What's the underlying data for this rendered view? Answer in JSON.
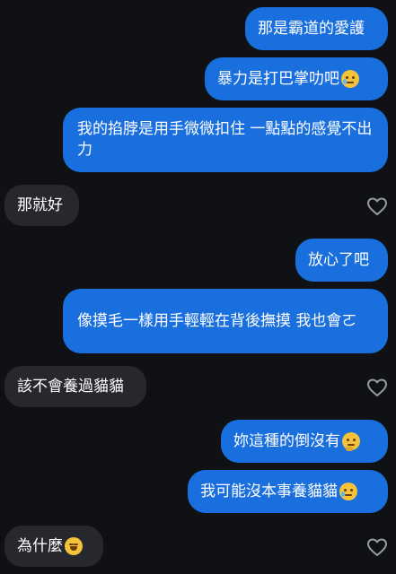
{
  "conversation": {
    "messages": [
      {
        "direction": "outgoing",
        "text": "那是霸道的愛護"
      },
      {
        "direction": "outgoing",
        "text": "暴力是打巴掌叻吧",
        "emoji": "face-holding-back-tears"
      },
      {
        "direction": "outgoing",
        "text": "我的掐脖是用手微微扣住 一點點的感覺不出力"
      },
      {
        "direction": "incoming",
        "text": "那就好"
      },
      {
        "direction": "outgoing",
        "text": "放心了吧"
      },
      {
        "direction": "outgoing",
        "text": "像摸毛一樣用手輕輕在背後撫摸 我也會ㄛ"
      },
      {
        "direction": "incoming",
        "text": "該不會養過貓貓"
      },
      {
        "direction": "outgoing",
        "text": "妳這種的倒沒有",
        "emoji": "thinking-face"
      },
      {
        "direction": "outgoing",
        "text": "我可能沒本事養貓貓",
        "emoji": "face-holding-back-tears"
      },
      {
        "direction": "incoming",
        "text": "為什麼",
        "emoji": "grinning-squinting-face"
      }
    ]
  },
  "colors": {
    "background": "#0f1115",
    "outgoing_bubble": "#1a6fdf",
    "incoming_bubble": "#26282d",
    "text": "#ffffff",
    "heart_outline": "#9a9ca3"
  },
  "icons": {
    "like": "heart-outline-icon"
  }
}
